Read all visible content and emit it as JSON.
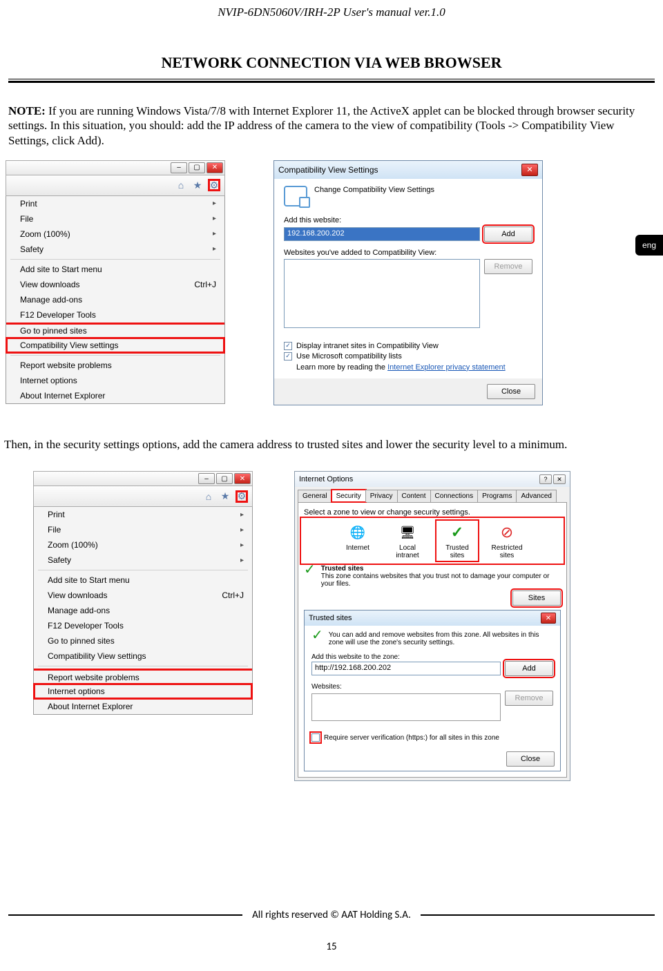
{
  "doc_header": "NVIP-6DN5060V/IRH-2P User's manual ver.1.0",
  "section_title": "NETWORK CONNECTION VIA WEB BROWSER",
  "lang_tab": "eng",
  "note_label": "NOTE:",
  "note_text": " If you are running Windows Vista/7/8 with Internet Explorer 11, the ActiveX applet can be blocked through browser security settings. In this situation, you should: add the IP address of the camera to the view of compatibility (Tools -> Compatibility View Settings, click Add).",
  "mid_text": "Then, in the security settings options, add the camera address to trusted sites and lower the security level to a minimum.",
  "ie_menu": {
    "items": [
      {
        "label": "Print",
        "arrow": true
      },
      {
        "label": "File",
        "arrow": true
      },
      {
        "label": "Zoom (100%)",
        "arrow": true
      },
      {
        "label": "Safety",
        "arrow": true
      }
    ],
    "items2": [
      {
        "label": "Add site to Start menu"
      },
      {
        "label": "View downloads",
        "shortcut": "Ctrl+J"
      },
      {
        "label": "Manage add-ons"
      },
      {
        "label": "F12 Developer Tools"
      },
      {
        "label": "Go to pinned sites"
      },
      {
        "label": "Compatibility View settings"
      }
    ],
    "items3": [
      {
        "label": "Report website problems"
      },
      {
        "label": "Internet options"
      },
      {
        "label": "About Internet Explorer"
      }
    ]
  },
  "compat": {
    "title": "Compatibility View Settings",
    "header": "Change Compatibility View Settings",
    "add_label": "Add this website:",
    "add_value": "192.168.200.202",
    "add_btn": "Add",
    "list_label": "Websites you've added to Compatibility View:",
    "remove_btn": "Remove",
    "chk1": "Display intranet sites in Compatibility View",
    "chk2": "Use Microsoft compatibility lists",
    "learn": "Learn more by reading the ",
    "learn_link": "Internet Explorer privacy statement",
    "close": "Close"
  },
  "io": {
    "title": "Internet Options",
    "tabs": [
      "General",
      "Security",
      "Privacy",
      "Content",
      "Connections",
      "Programs",
      "Advanced"
    ],
    "zone_prompt": "Select a zone to view or change security settings.",
    "zones": [
      "Internet",
      "Local intranet",
      "Trusted sites",
      "Restricted sites"
    ],
    "zone_desc_title": "Trusted sites",
    "zone_desc": "This zone contains websites that you trust not to damage your computer or your files.",
    "sites_btn": "Sites"
  },
  "ts": {
    "title": "Trusted sites",
    "info": "You can add and remove websites from this zone. All websites in this zone will use the zone's security settings.",
    "add_label": "Add this website to the zone:",
    "add_value": "http://192.168.200.202",
    "add_btn": "Add",
    "list_label": "Websites:",
    "remove_btn": "Remove",
    "chk": "Require server verification (https:) for all sites in this zone",
    "close": "Close"
  },
  "footer": "All rights reserved © AAT Holding S.A.",
  "page_number": "15"
}
